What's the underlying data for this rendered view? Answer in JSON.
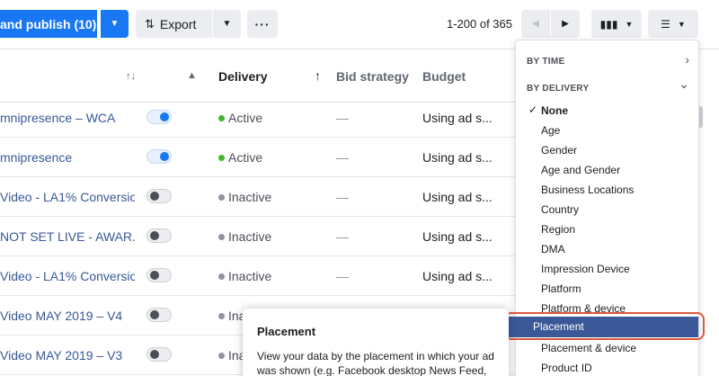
{
  "toolbar": {
    "publish_label": "and publish (10)",
    "publish_caret": "▼",
    "export_label": "Export",
    "export_icon": "⇅",
    "export_caret": "▼",
    "more_label": "···",
    "range_text": "1-200 of 365",
    "prev_icon": "◀",
    "next_icon": "▶",
    "columns_icon": "▮▮▮",
    "columns_caret": "▼",
    "breakdown_icon": "☰",
    "breakdown_caret": "▼"
  },
  "table": {
    "headers": {
      "sort_icon": "↑↓",
      "warning_icon": "▲",
      "delivery": "Delivery",
      "delivery_sort": "↑",
      "bid_strategy": "Bid strategy",
      "budget": "Budget"
    },
    "rows": [
      {
        "name": "mnipresence – WCA",
        "toggle": "on",
        "status": "Active",
        "status_color": "#42b72a",
        "bid": "—",
        "budget": "Using ad s..."
      },
      {
        "name": "mnipresence",
        "toggle": "on",
        "status": "Active",
        "status_color": "#42b72a",
        "bid": "—",
        "budget": "Using ad s..."
      },
      {
        "name": "Video - LA1% Conversio...",
        "toggle": "off",
        "status": "Inactive",
        "status_color": "#8d949e",
        "bid": "—",
        "budget": "Using ad s..."
      },
      {
        "name": "NOT SET LIVE - AWAR...",
        "toggle": "off",
        "status": "Inactive",
        "status_color": "#8d949e",
        "bid": "—",
        "budget": "Using ad s..."
      },
      {
        "name": "Video - LA1% Conversio...",
        "toggle": "off",
        "status": "Inactive",
        "status_color": "#8d949e",
        "bid": "—",
        "budget": "Using ad s..."
      },
      {
        "name": "Video MAY 2019 – V4",
        "toggle": "off",
        "status": "Ina",
        "status_color": "#8d949e",
        "bid": "",
        "budget": ""
      },
      {
        "name": "Video MAY 2019 – V3",
        "toggle": "off",
        "status": "Ina",
        "status_color": "#8d949e",
        "bid": "",
        "budget": ""
      }
    ]
  },
  "breakdown_menu": {
    "by_time_label": "BY TIME",
    "by_time_chevron": "›",
    "by_delivery_label": "BY DELIVERY",
    "by_delivery_chevron": "⌄",
    "check_icon": "✓",
    "options": [
      "None",
      "Age",
      "Gender",
      "Age and Gender",
      "Business Locations",
      "Country",
      "Region",
      "DMA",
      "Impression Device",
      "Platform",
      "Platform & device",
      "Placement",
      "Placement & device",
      "Product ID"
    ],
    "selected": "None",
    "highlighted": "Placement"
  },
  "tooltip": {
    "title": "Placement",
    "body": "View your data by the placement in which your ad was shown (e.g. Facebook desktop News Feed, Instagram"
  },
  "colors": {
    "accent": "#1877f2",
    "highlight": "#3b5998",
    "highlight_ring": "#e0583a",
    "link": "#385898"
  }
}
